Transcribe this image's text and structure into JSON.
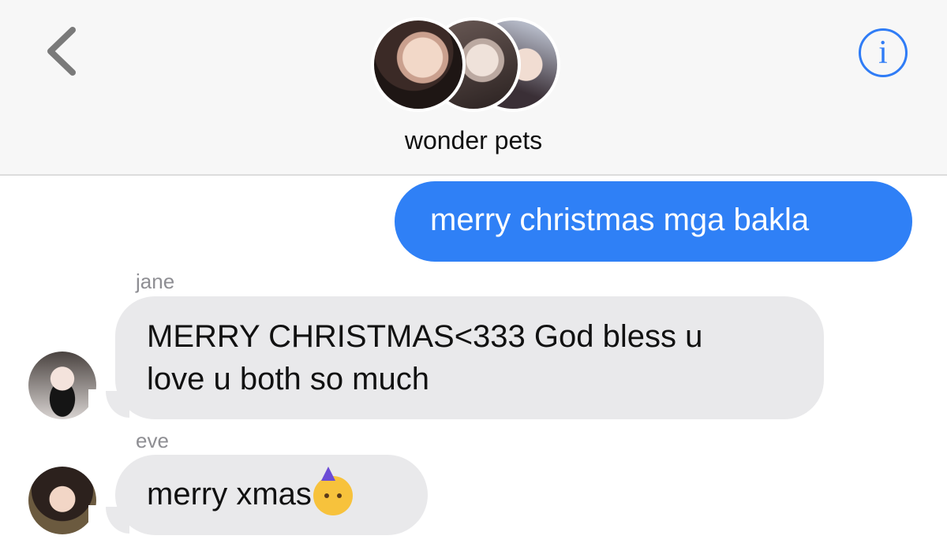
{
  "header": {
    "group_name": "wonder pets",
    "back_icon": "chevron-left-icon",
    "info_icon": "info-icon",
    "info_glyph": "i",
    "accent": "#2f7cf6"
  },
  "messages": [
    {
      "direction": "outgoing",
      "text": "merry christmas mga bakla"
    },
    {
      "direction": "incoming",
      "sender": "jane",
      "line1": "MERRY CHRISTMAS<333 God bless u",
      "line2": "love u both so much"
    },
    {
      "direction": "incoming",
      "sender": "eve",
      "text": "merry xmas",
      "emoji": "partying-face-icon"
    }
  ],
  "colors": {
    "outgoing_bubble": "#2f80f6",
    "incoming_bubble": "#e9e9eb",
    "sender_label": "#8e8e93"
  }
}
